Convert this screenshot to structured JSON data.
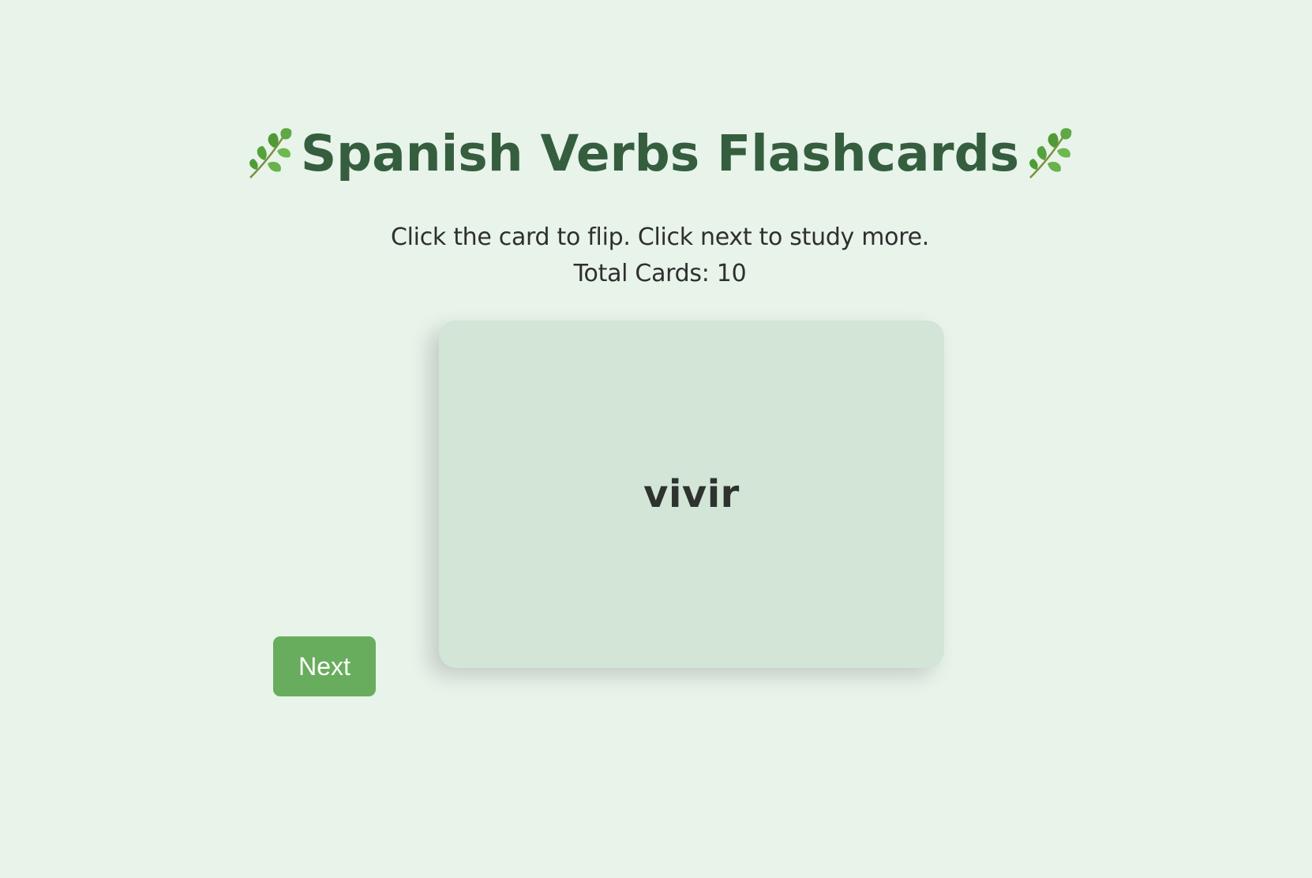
{
  "header": {
    "title": "Spanish Verbs Flashcards",
    "left_icon": "herb-leaf-icon",
    "right_icon": "herb-leaf-icon"
  },
  "instructions": "Click the card to flip. Click next to study more.",
  "counter_text": "Total Cards: 10",
  "flashcard": {
    "front_text": "vivir"
  },
  "controls": {
    "next_label": "Next"
  },
  "colors": {
    "background": "#e8f3ea",
    "title": "#355e3f",
    "card": "#d2e5d7",
    "button": "#68ad5d"
  }
}
